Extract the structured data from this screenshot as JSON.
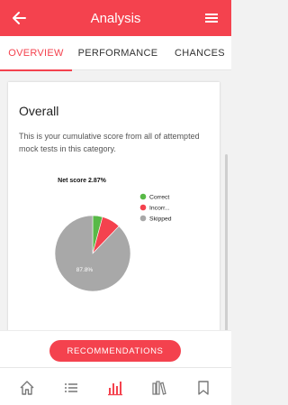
{
  "header": {
    "title": "Analysis",
    "back_icon": "arrow-left-icon",
    "menu_icon": "hamburger-menu-icon"
  },
  "tabs": [
    {
      "label": "OVERVIEW",
      "active": true
    },
    {
      "label": "PERFORMANCE",
      "active": false
    },
    {
      "label": "CHANCES",
      "active": false
    }
  ],
  "overall": {
    "heading": "Overall",
    "description": "This is your cumulative score from all of attempted mock tests in this category."
  },
  "chart_data": {
    "type": "pie",
    "title": "Net score 2.87%",
    "categories": [
      "Correct",
      "Incorr...",
      "Skipped"
    ],
    "values": [
      4.2,
      8.0,
      87.8
    ],
    "slice_label": "87.8%",
    "colors": [
      "#58b947",
      "#f4424e",
      "#a8a8a8"
    ],
    "legend_position": "top-right"
  },
  "actions": {
    "recommendations_label": "RECOMMENDATIONS"
  },
  "bottom_nav": [
    {
      "icon": "home-icon",
      "active": false
    },
    {
      "icon": "list-icon",
      "active": false
    },
    {
      "icon": "bar-chart-icon",
      "active": true
    },
    {
      "icon": "library-icon",
      "active": false
    },
    {
      "icon": "bookmark-icon",
      "active": false
    }
  ],
  "colors": {
    "accent": "#f4424e",
    "text": "#222222",
    "muted": "#555555"
  }
}
